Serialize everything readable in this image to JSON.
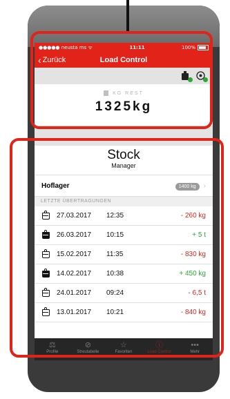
{
  "status": {
    "carrier": "●●●●● neusta ms ᯤ",
    "time": "11:11",
    "battery": "100%"
  },
  "nav": {
    "back_label": "Zurück",
    "title": "Load Control"
  },
  "icons": [
    "scale-icon",
    "tractor-icon"
  ],
  "rest": {
    "label": "KG REST",
    "value": "1325kg"
  },
  "stock": {
    "title": "Stock",
    "subtitle": "Manager"
  },
  "hoflager": {
    "label": "Hoflager",
    "badge": "1400 kg",
    "chevron": "›"
  },
  "section_header": "LETZTE ÜBERTRAGUNGEN",
  "transfers": [
    {
      "date": "27.03.2017",
      "time": "12:35",
      "amount": "- 260 kg",
      "sign": "neg",
      "filled": false
    },
    {
      "date": "26.03.2017",
      "time": "10:15",
      "amount": "+ 5 t",
      "sign": "pos",
      "filled": true
    },
    {
      "date": "15.02.2017",
      "time": "11:35",
      "amount": "- 830 kg",
      "sign": "neg",
      "filled": false
    },
    {
      "date": "14.02.2017",
      "time": "10:38",
      "amount": "+ 450 kg",
      "sign": "pos",
      "filled": true
    },
    {
      "date": "24.01.2017",
      "time": "09:24",
      "amount": "- 6,5 t",
      "sign": "neg",
      "filled": false
    },
    {
      "date": "13.01.2017",
      "time": "10:21",
      "amount": "- 840 kg",
      "sign": "neg",
      "filled": false
    }
  ],
  "tabs": [
    {
      "label": "Profile",
      "icon": "⚖"
    },
    {
      "label": "Streutabelle",
      "icon": "⊘"
    },
    {
      "label": "Favoriten",
      "icon": "☆"
    },
    {
      "label": "Load Control",
      "icon": "ⓘ",
      "active": true
    },
    {
      "label": "Mehr",
      "icon": "•••"
    }
  ],
  "colors": {
    "accent": "#e2231a",
    "negative": "#d9261c",
    "positive": "#2aa836"
  }
}
